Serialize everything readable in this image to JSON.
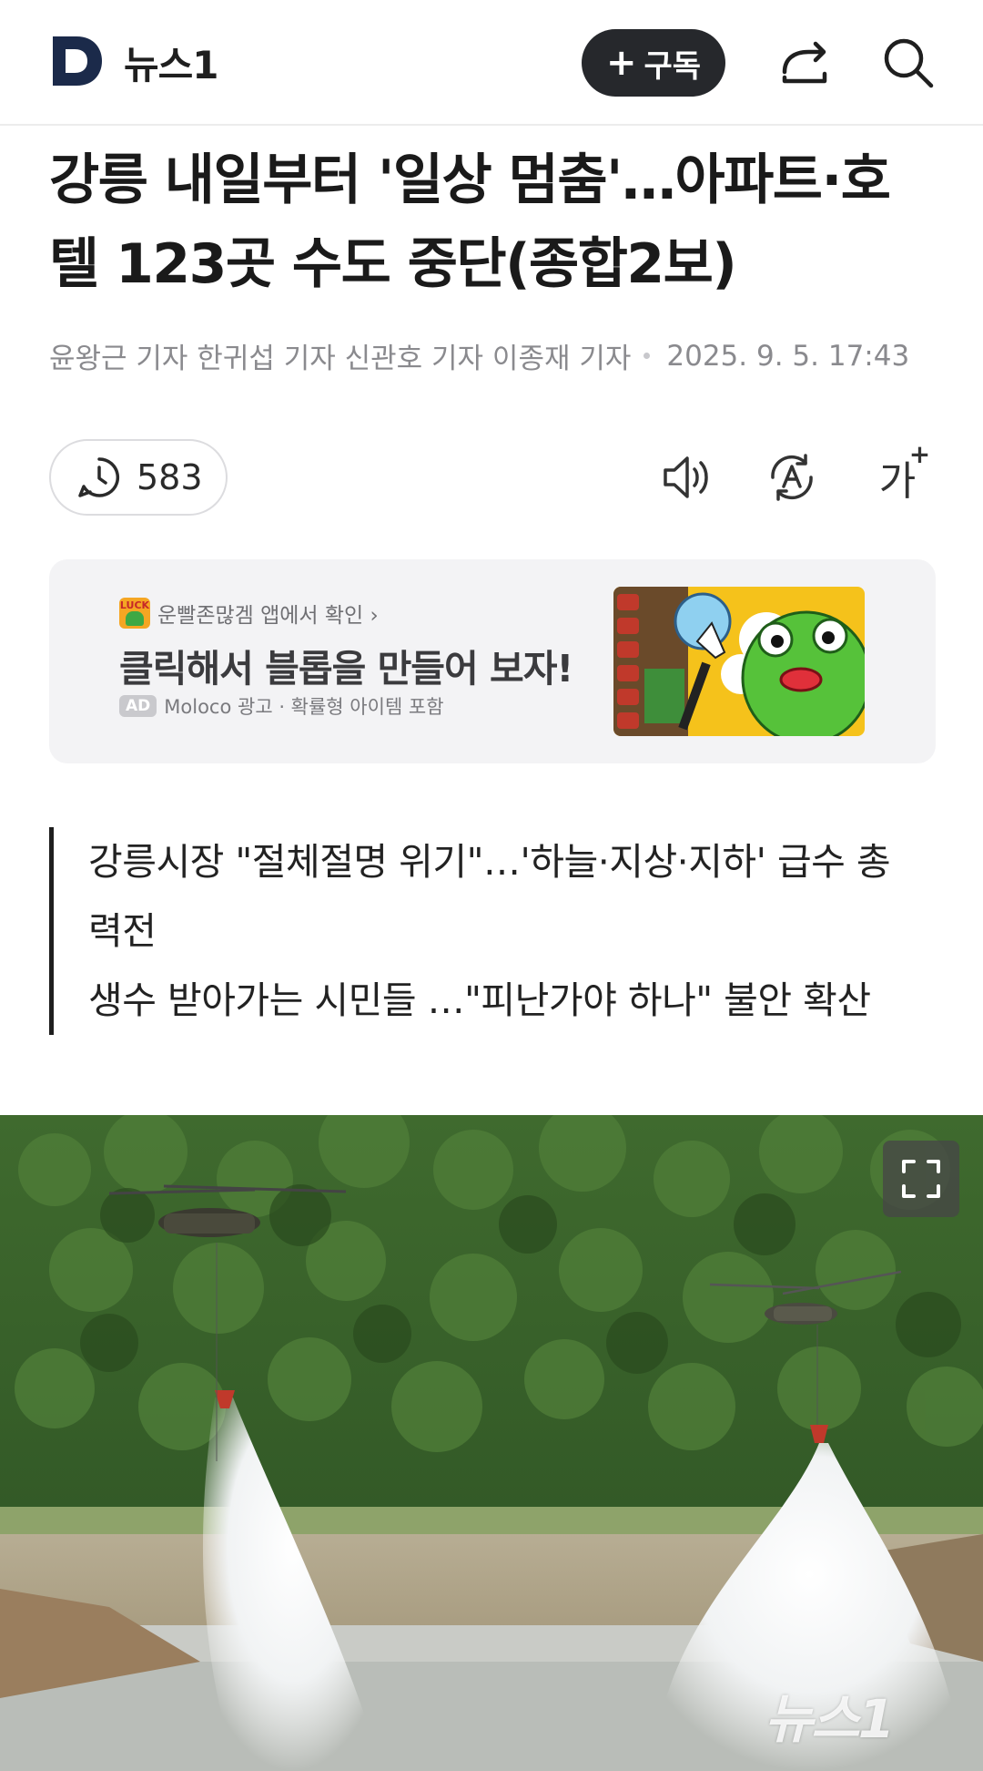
{
  "header": {
    "logo_letter": "D",
    "brand": "뉴스1",
    "subscribe_label": "구독",
    "subscribe_plus": "+"
  },
  "article": {
    "title_line1": "강릉 내일부터 '일상 멈춤'…아파트·호",
    "title_line2": "텔 123곳 수도 중단(종합2보)",
    "byline": "윤왕근 기자 한귀섭 기자 신관호 기자 이종재 기자",
    "date": "2025. 9. 5. 17:43",
    "comment_count": "583",
    "font_size_glyph": "가",
    "font_size_plus": "+",
    "summary": [
      "강릉시장 \"절체절명 위기\"…'하늘·지상·지하' 급수 총",
      "력전",
      "생수 받아가는 시민들 …\"피난가야 하나\" 불안 확산"
    ]
  },
  "ad": {
    "app_icon_text": "LUCK",
    "app_line": "운빨존많겜 앱에서 확인 ›",
    "headline": "클릭해서 블롭을 만들어 보자!",
    "badge": "AD",
    "meta": "Moloco 광고 · 확률형 아이템 포함"
  },
  "photo": {
    "watermark": "뉴스1"
  },
  "icons": {
    "share": "share-icon",
    "search": "search-icon",
    "comment": "comment-icon",
    "tts": "speaker-icon",
    "translate": "translate-icon",
    "expand": "expand-icon"
  },
  "colors": {
    "brand_navy": "#1b2a4a",
    "subscribe_bg": "#26282c",
    "ad_bg": "#f3f3f5",
    "byline_gray": "#8a8a8e"
  }
}
